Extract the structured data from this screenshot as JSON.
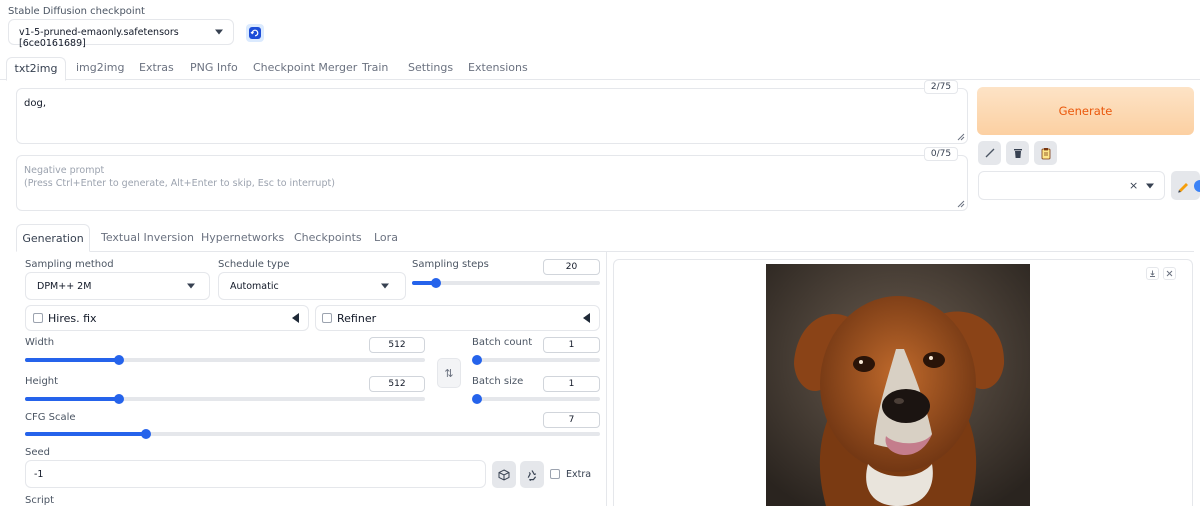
{
  "checkpoint": {
    "label": "Stable Diffusion checkpoint",
    "selected": "v1-5-pruned-emaonly.safetensors [6ce0161689]"
  },
  "main_tabs": [
    {
      "label": "txt2img"
    },
    {
      "label": "img2img"
    },
    {
      "label": "Extras"
    },
    {
      "label": "PNG Info"
    },
    {
      "label": "Checkpoint Merger"
    },
    {
      "label": "Train"
    },
    {
      "label": "Settings"
    },
    {
      "label": "Extensions"
    }
  ],
  "prompt": {
    "value": "dog,",
    "token_count": "2/75"
  },
  "negative_prompt": {
    "placeholder_line1": "Negative prompt",
    "placeholder_line2": "(Press Ctrl+Enter to generate, Alt+Enter to skip, Esc to interrupt)",
    "token_count": "0/75"
  },
  "generate": {
    "label": "Generate",
    "bg": "#fdd8b0",
    "text_color": "#ea580c"
  },
  "tool_icons": [
    "pencil-line-icon",
    "trash-icon",
    "clipboard-icon"
  ],
  "style_select": {
    "value": "",
    "clear_symbol": "×"
  },
  "sub_tabs": [
    {
      "label": "Generation"
    },
    {
      "label": "Textual Inversion"
    },
    {
      "label": "Hypernetworks"
    },
    {
      "label": "Checkpoints"
    },
    {
      "label": "Lora"
    }
  ],
  "sampling_method": {
    "label": "Sampling method",
    "value": "DPM++ 2M"
  },
  "schedule_type": {
    "label": "Schedule type",
    "value": "Automatic"
  },
  "sampling_steps": {
    "label": "Sampling steps",
    "value": "20",
    "fraction": 0.13
  },
  "hires_fix": {
    "label": "Hires. fix"
  },
  "refiner": {
    "label": "Refiner"
  },
  "width": {
    "label": "Width",
    "value": "512",
    "fraction": 0.235
  },
  "height": {
    "label": "Height",
    "value": "512",
    "fraction": 0.235
  },
  "swap_symbol": "⇅",
  "batch_count": {
    "label": "Batch count",
    "value": "1",
    "fraction": 0.0
  },
  "batch_size": {
    "label": "Batch size",
    "value": "1",
    "fraction": 0.0
  },
  "cfg_scale": {
    "label": "CFG Scale",
    "value": "7",
    "fraction": 0.21
  },
  "seed": {
    "label": "Seed",
    "value": "-1",
    "extra_label": "Extra"
  },
  "script": {
    "label": "Script"
  },
  "colors": {
    "accent": "#2563eb",
    "border": "#e5e7eb"
  }
}
